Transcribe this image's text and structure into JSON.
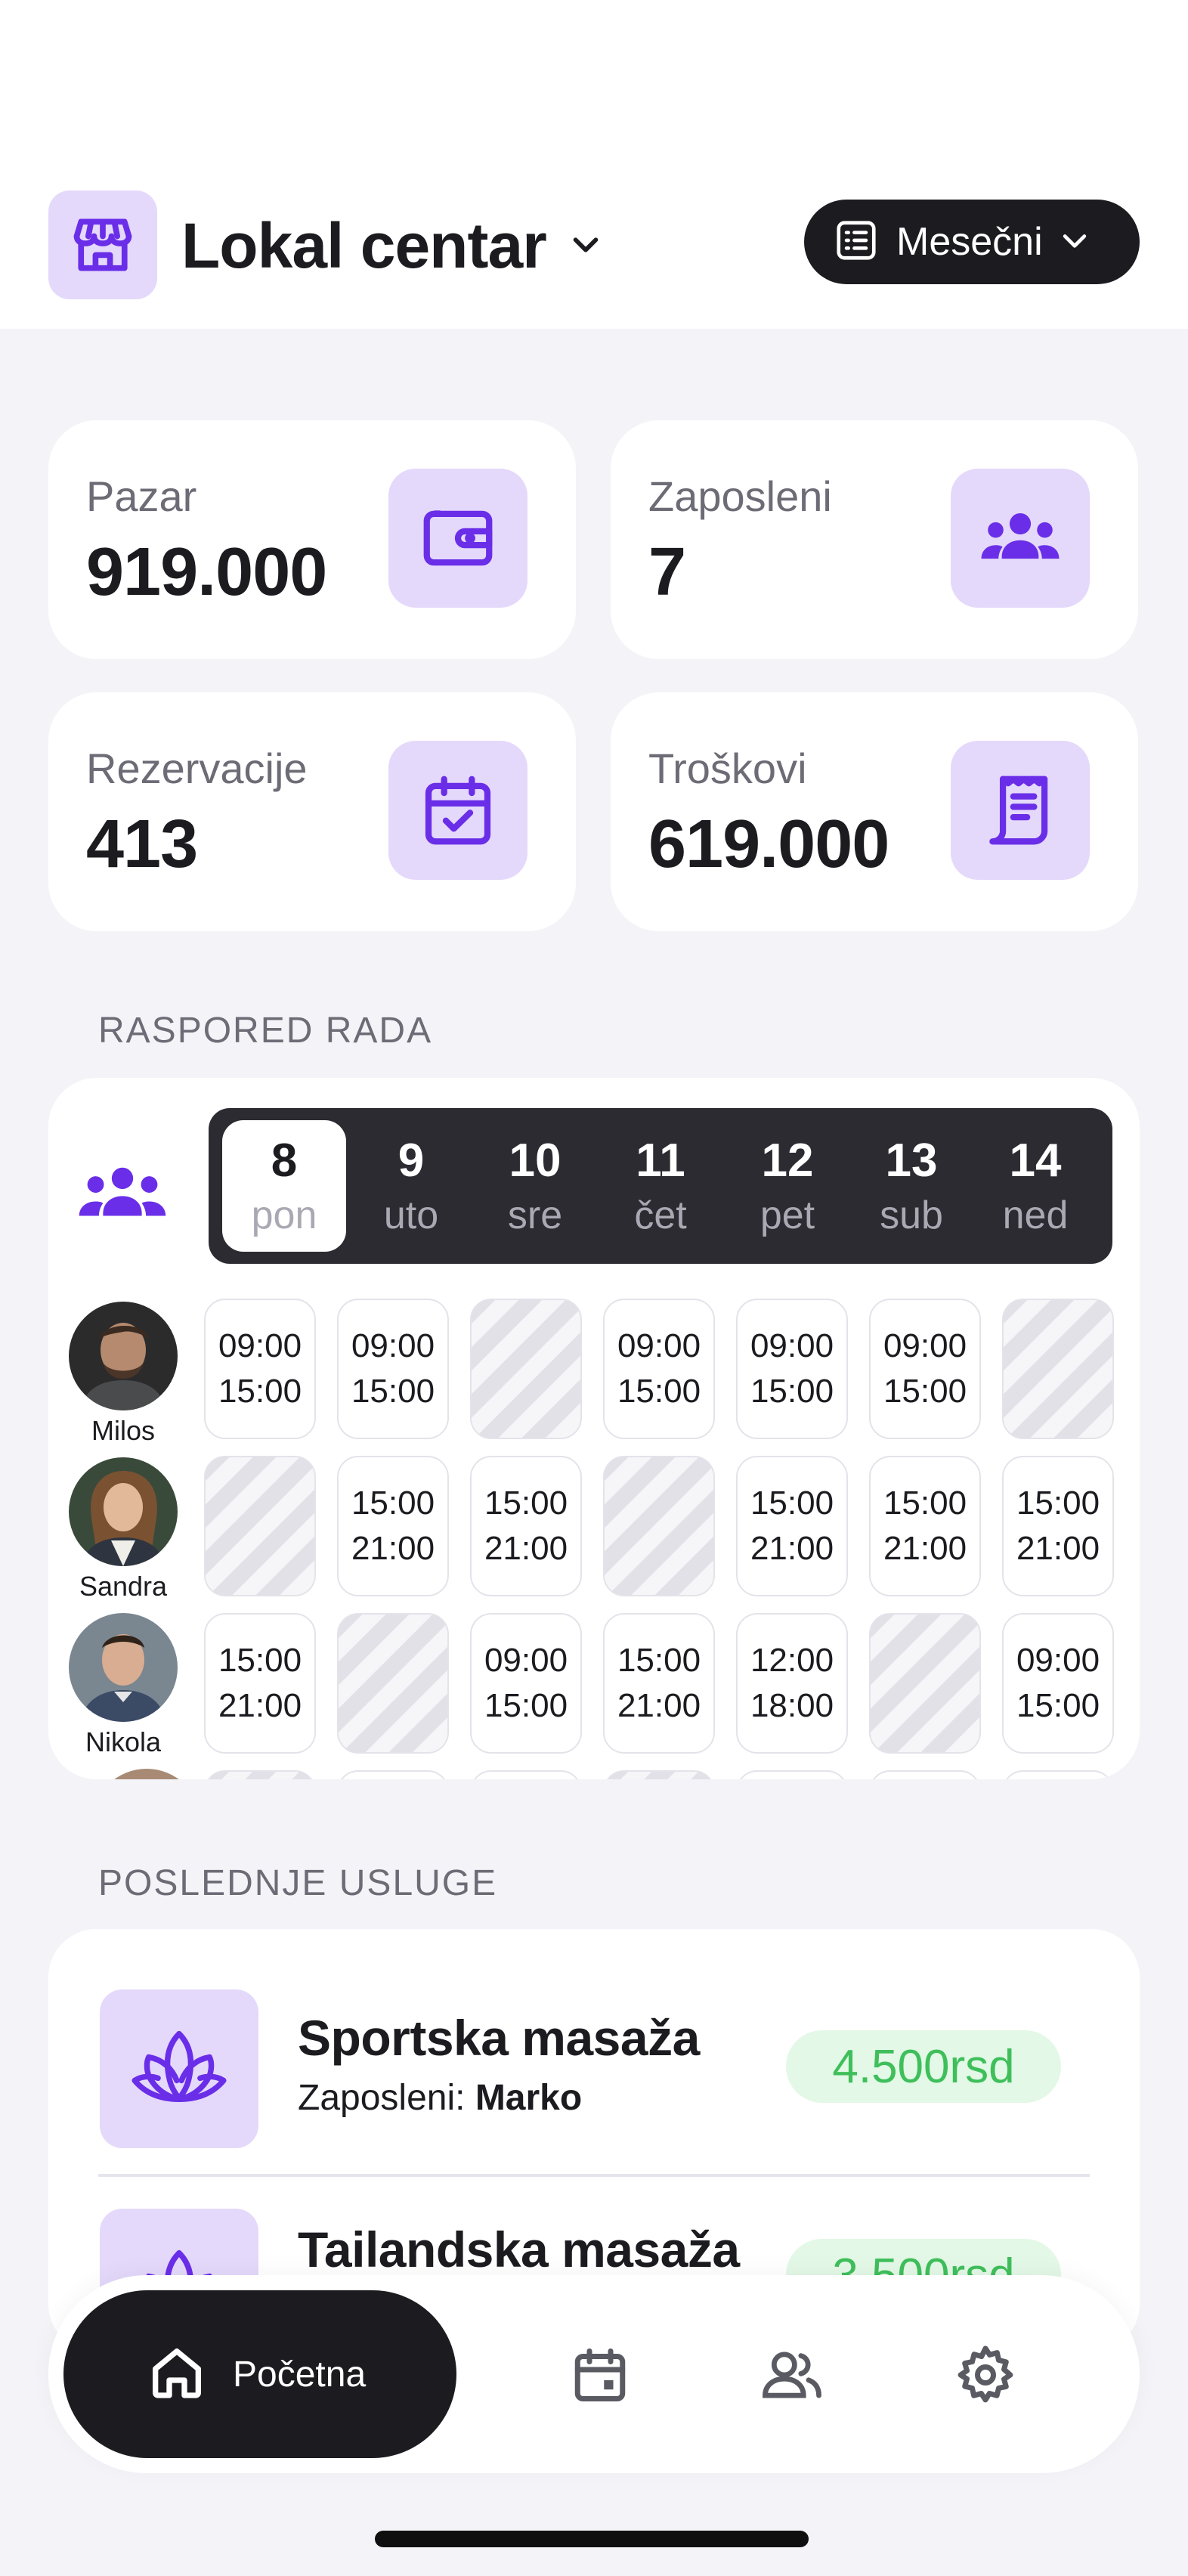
{
  "header": {
    "store_name": "Lokal centar",
    "period_label": "Mesečni",
    "icons": {
      "store": "storefront-icon",
      "dropdown": "chevron-down-icon",
      "period": "list-icon"
    }
  },
  "stats": [
    {
      "title": "Pazar",
      "value": "919.000",
      "icon": "wallet-icon"
    },
    {
      "title": "Zaposleni",
      "value": "7",
      "icon": "people-icon"
    },
    {
      "title": "Rezervacije",
      "value": "413",
      "icon": "calendar-check-icon"
    },
    {
      "title": "Troškovi",
      "value": "619.000",
      "icon": "receipt-icon"
    }
  ],
  "schedule": {
    "section_label": "RASPORED RADA",
    "days": [
      {
        "num": "8",
        "name": "pon",
        "active": true
      },
      {
        "num": "9",
        "name": "uto"
      },
      {
        "num": "10",
        "name": "sre"
      },
      {
        "num": "11",
        "name": "čet"
      },
      {
        "num": "12",
        "name": "pet"
      },
      {
        "num": "13",
        "name": "sub"
      },
      {
        "num": "14",
        "name": "ned"
      }
    ],
    "employees": [
      {
        "name": "Milos",
        "shifts": [
          [
            "09:00",
            "15:00"
          ],
          [
            "09:00",
            "15:00"
          ],
          null,
          [
            "09:00",
            "15:00"
          ],
          [
            "09:00",
            "15:00"
          ],
          [
            "09:00",
            "15:00"
          ],
          null
        ]
      },
      {
        "name": "Sandra",
        "shifts": [
          null,
          [
            "15:00",
            "21:00"
          ],
          [
            "15:00",
            "21:00"
          ],
          null,
          [
            "15:00",
            "21:00"
          ],
          [
            "15:00",
            "21:00"
          ],
          [
            "15:00",
            "21:00"
          ]
        ]
      },
      {
        "name": "Nikola",
        "shifts": [
          [
            "15:00",
            "21:00"
          ],
          null,
          [
            "09:00",
            "15:00"
          ],
          [
            "15:00",
            "21:00"
          ],
          [
            "12:00",
            "18:00"
          ],
          null,
          [
            "09:00",
            "15:00"
          ]
        ]
      }
    ]
  },
  "services": {
    "section_label": "POSLEDNJE USLUGE",
    "employee_prefix": "Zaposleni:",
    "items": [
      {
        "name": "Sportska masaža",
        "employee": "Marko",
        "price": "4.500rsd",
        "icon": "lotus-icon"
      },
      {
        "name": "Tailandska masaža",
        "employee": "",
        "price": "3.500rsd",
        "icon": "lotus-icon"
      }
    ]
  },
  "nav": {
    "home_label": "Početna",
    "items": [
      "home-icon",
      "calendar-icon",
      "users-icon",
      "settings-icon"
    ]
  },
  "colors": {
    "accent": "#6a2ee8",
    "accent_bg": "#e4d9fb",
    "dark": "#1c1b20",
    "price_green": "#3fbf5b",
    "price_bg": "#e3f8e6"
  }
}
